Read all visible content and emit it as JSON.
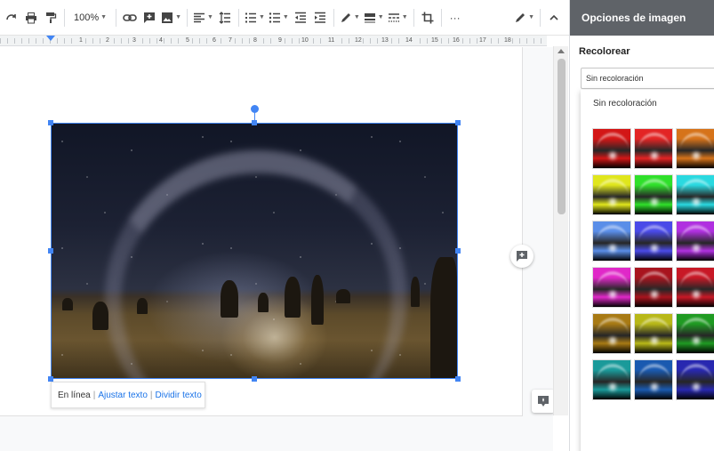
{
  "toolbar": {
    "zoom": "100%",
    "more_label": "···"
  },
  "ruler": {
    "numbers": [
      "1",
      "2",
      "3",
      "4",
      "5",
      "6",
      "7",
      "8",
      "9",
      "10",
      "11",
      "12",
      "13",
      "14",
      "15",
      "16",
      "17",
      "18"
    ]
  },
  "wrap": {
    "inline": "En línea",
    "wrap_text": "Ajustar texto",
    "break_text": "Dividir texto",
    "separator": "|"
  },
  "panel": {
    "title": "Opciones de imagen",
    "section": "Recolorear",
    "selected": "Sin recoloración",
    "menu_first_option": "Sin recoloración",
    "swatch_colors": [
      "#d31616",
      "#e32424",
      "#d6731a",
      "#e0e61c",
      "#2fe02a",
      "#2ad9e0",
      "#5a8ee8",
      "#4a4ae8",
      "#b030e0",
      "#e028c8",
      "#a8141e",
      "#c81826",
      "#a87a14",
      "#b8b818",
      "#1f9a22",
      "#1a9a9a",
      "#1a5ab0",
      "#2828b0"
    ]
  },
  "colors": {
    "selection": "#4285f4",
    "panel_header": "#5f6368",
    "link": "#1a73e8"
  }
}
